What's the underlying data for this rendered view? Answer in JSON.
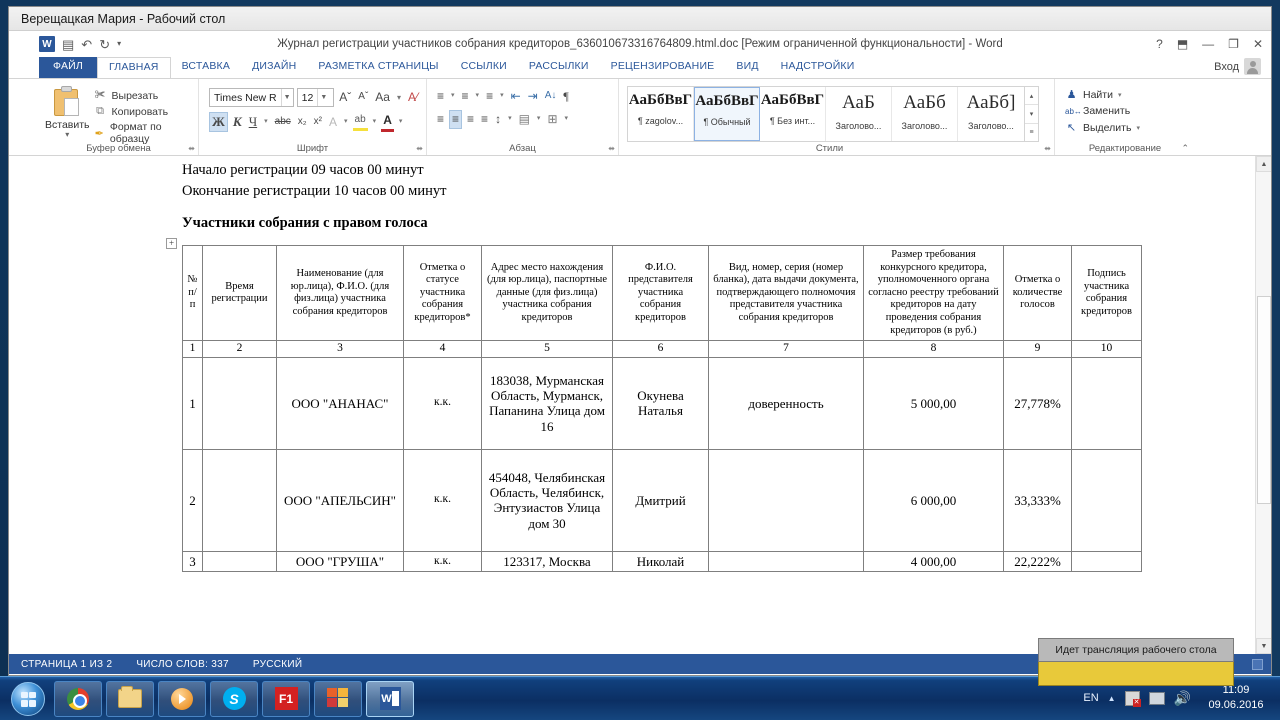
{
  "session": {
    "title": "Верещацкая Мария - Рабочий стол"
  },
  "word": {
    "doc_title": "Журнал регистрации участников собрания кредиторов_636010673316764809.html.doc [Режим ограниченной функциональности] - Word",
    "qat": {
      "word_icon": "word-icon",
      "save": "▤",
      "undo": "↶",
      "redo": "↻",
      "more": "▾"
    },
    "window_controls": {
      "help": "?",
      "ribbon_options": "⬒",
      "minimize": "—",
      "restore": "❐",
      "close": "✕"
    },
    "signin": {
      "label": "Вход",
      "avatar": "user-avatar-icon"
    },
    "tabs": [
      {
        "label": "ФАЙЛ",
        "state": "file"
      },
      {
        "label": "ГЛАВНАЯ",
        "state": "active"
      },
      {
        "label": "ВСТАВКА",
        "state": "normal"
      },
      {
        "label": "ДИЗАЙН",
        "state": "normal"
      },
      {
        "label": "РАЗМЕТКА СТРАНИЦЫ",
        "state": "normal"
      },
      {
        "label": "ССЫЛКИ",
        "state": "normal"
      },
      {
        "label": "РАССЫЛКИ",
        "state": "normal"
      },
      {
        "label": "РЕЦЕНЗИРОВАНИЕ",
        "state": "normal"
      },
      {
        "label": "ВИД",
        "state": "normal"
      },
      {
        "label": "НАДСТРОЙКИ",
        "state": "normal"
      }
    ],
    "groups": {
      "clipboard": {
        "label": "Буфер обмена",
        "paste": "Вставить",
        "paste_caret": "▾",
        "items": [
          {
            "icon": "scissors-icon",
            "glyph": "✀",
            "label": "Вырезать"
          },
          {
            "icon": "copy-icon",
            "glyph": "⧉",
            "label": "Копировать"
          },
          {
            "icon": "format-painter-icon",
            "glyph": "✒",
            "label": "Формат по образцу"
          }
        ],
        "dialog_launcher": "⬌"
      },
      "font": {
        "label": "Шрифт",
        "font_name": "Times New R",
        "font_size": "12",
        "grow": "Aˇ",
        "shrink": "Aˇ",
        "change_case": "Aa",
        "clear_format": "A⁄",
        "bold": "Ж",
        "italic": "К",
        "underline": "Ч",
        "strikethrough": "abc",
        "subscript": "x₂",
        "superscript": "x²",
        "text_effects": "A",
        "highlight": "ab",
        "font_color": "A",
        "dialog_launcher": "⬌"
      },
      "paragraph": {
        "label": "Абзац",
        "bullets": "≡",
        "numbering": "≡",
        "multilevel": "≡",
        "decrease_indent": "⇤",
        "increase_indent": "⇥",
        "sort": "A↓",
        "marks": "¶",
        "align_left": "≡",
        "align_center": "≡",
        "align_right": "≡",
        "justify": "≡",
        "line_spacing": "↕",
        "shading": "▤",
        "borders": "⊞",
        "dialog_launcher": "⬌"
      },
      "styles": {
        "label": "Стили",
        "items": [
          {
            "sample": "АаБбВвГ",
            "name": "¶ zagolov...",
            "selected": false,
            "kind": "bold"
          },
          {
            "sample": "АаБбВвГ",
            "name": "¶ Обычный",
            "selected": true,
            "kind": "bold"
          },
          {
            "sample": "АаБбВвГ",
            "name": "¶ Без инт...",
            "selected": false,
            "kind": "bold"
          },
          {
            "sample": "АаБ",
            "name": "Заголово...",
            "selected": false,
            "kind": "light"
          },
          {
            "sample": "АаБб",
            "name": "Заголово...",
            "selected": false,
            "kind": "light"
          },
          {
            "sample": "АаБб]",
            "name": "Заголово...",
            "selected": false,
            "kind": "light"
          }
        ],
        "nav": {
          "up": "▴",
          "down": "▾",
          "more": "≡"
        },
        "dialog_launcher": "⬌"
      },
      "editing": {
        "label": "Редактирование",
        "items": [
          {
            "icon": "binoculars-icon",
            "glyph": "♟",
            "label": "Найти",
            "caret": "▾"
          },
          {
            "icon": "replace-icon",
            "glyph": "ab↔",
            "label": "Заменить",
            "caret": ""
          },
          {
            "icon": "select-icon",
            "glyph": "↖",
            "label": "Выделить",
            "caret": "▾"
          }
        ],
        "collapse": "⌃"
      }
    },
    "status_bar": {
      "page": "СТРАНИЦА 1 ИЗ 2",
      "words": "ЧИСЛО СЛОВ: 337",
      "language": "РУССКИЙ",
      "view_icon": "reading-view-icon"
    },
    "scrollbar": {
      "up": "▲",
      "down": "▼",
      "name": "vertical-scrollbar"
    }
  },
  "document": {
    "lines": [
      "Начало регистрации 09 часов 00 минут",
      "Окончание регистрации 10 часов 00 минут"
    ],
    "heading": "Участники собрания с правом голоса",
    "table_handle": "+",
    "table": {
      "headers": [
        "№ п/п",
        "Время регистрации",
        "Наименование (для юр.лица), Ф.И.О. (для физ.лица) участника собрания кредиторов",
        "Отметка о статусе участника собрания кредиторов*",
        "Адрес место нахождения (для юр.лица), паспортные данные (для физ.лица) участника собрания кредиторов",
        "Ф.И.О. представителя участника собрания кредиторов",
        "Вид, номер, серия (номер бланка), дата выдачи документа, подтверждающего полномочия представителя участника собрания кредиторов",
        "Размер требования конкурсного кредитора, уполномоченного органа согласно реестру требований кредиторов на дату проведения собрания кредиторов (в руб.)",
        "Отметка о количестве голосов",
        "Подпись участника собрания кредиторов"
      ],
      "column_numbers": [
        "1",
        "2",
        "3",
        "4",
        "5",
        "6",
        "7",
        "8",
        "9",
        "10"
      ],
      "rows": [
        {
          "num": "1",
          "time": "",
          "name": "ООО \"АНАНАС\"",
          "status": "к.к.",
          "address": "183038, Мурманская Область, Мурманск, Папанина Улица дом 16",
          "representative": "Окунева Наталья",
          "document": "доверенность",
          "amount": "5 000,00",
          "votes": "27,778%",
          "signature": ""
        },
        {
          "num": "2",
          "time": "",
          "name": "ООО \"АПЕЛЬСИН\"",
          "status": "к.к.",
          "address": "454048, Челябинская Область, Челябинск, Энтузиастов Улица дом 30",
          "representative": "Дмитрий",
          "document": "",
          "amount": "6 000,00",
          "votes": "33,333%",
          "signature": ""
        },
        {
          "num": "3",
          "time": "",
          "name": "ООО \"ГРУША\"",
          "status": "к.к.",
          "address": "123317, Москва",
          "representative": "Николай",
          "document": "",
          "amount": "4 000,00",
          "votes": "22,222%",
          "signature": ""
        }
      ]
    }
  },
  "taskbar": {
    "start": "start-orb",
    "buttons": [
      {
        "name": "chrome",
        "active": false
      },
      {
        "name": "explorer",
        "active": false
      },
      {
        "name": "media-player",
        "active": false
      },
      {
        "name": "skype",
        "label": "S",
        "active": false
      },
      {
        "name": "f1",
        "label": "F1",
        "active": false
      },
      {
        "name": "windows-app",
        "active": false
      },
      {
        "name": "word",
        "label": "W",
        "active": true
      }
    ],
    "tray": {
      "language": "EN",
      "show_hidden": "▲",
      "icons": [
        "antivirus-icon",
        "network-icon",
        "volume-icon"
      ],
      "time": "11:09",
      "date": "09.06.2016"
    },
    "notification": "Идет трансляция рабочего стола"
  }
}
